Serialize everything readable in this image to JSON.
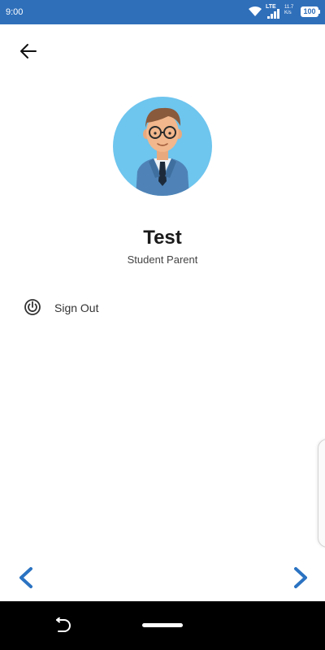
{
  "status_bar": {
    "time": "9:00",
    "network_label": "LTE",
    "speed_value": "11.7",
    "speed_unit": "K/s",
    "battery": "100"
  },
  "profile": {
    "name": "Test",
    "role": "Student Parent"
  },
  "menu": {
    "sign_out_label": "Sign Out"
  },
  "icons": {
    "back": "arrow-left-icon",
    "power": "power-icon",
    "prev": "chevron-left-icon",
    "next": "chevron-right-icon"
  },
  "colors": {
    "status_bar": "#2f6fba",
    "accent": "#2b73c2",
    "avatar_bg": "#6ec5ee"
  }
}
